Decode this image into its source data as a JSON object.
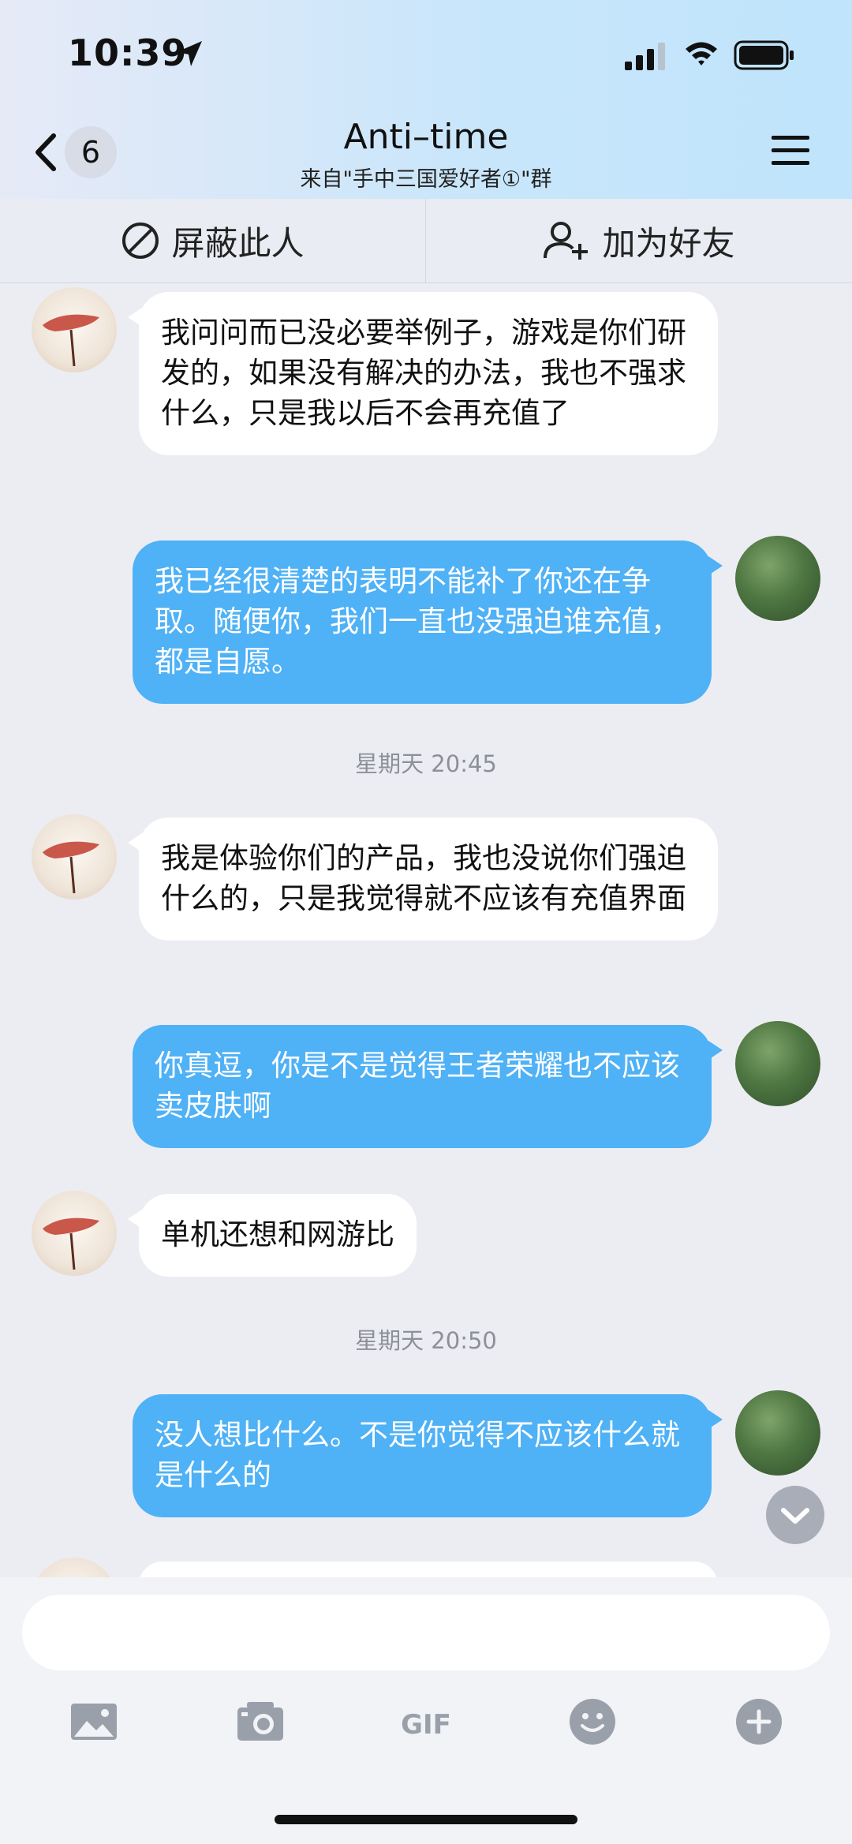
{
  "status_bar": {
    "time": "10:39"
  },
  "header": {
    "unread_count": "6",
    "title": "Anti–time",
    "subtitle": "来自\"手中三国爱好者①\"群"
  },
  "actions": {
    "block_label": "屏蔽此人",
    "add_friend_label": "加为好友"
  },
  "messages": [
    {
      "from": "other",
      "text": "我问问而已没必要举例子，游戏是你们研发的，如果没有解决的办法，我也不强求什么，只是我以后不会再充值了"
    },
    {
      "from": "self",
      "text": "我已经很清楚的表明不能补了你还在争取。随便你，我们一直也没强迫谁充值，都是自愿。"
    },
    {
      "timestamp": "星期天 20:45"
    },
    {
      "from": "other",
      "text": "我是体验你们的产品，我也没说你们强迫什么的，只是我觉得就不应该有充值界面"
    },
    {
      "from": "self",
      "text": "你真逗，你是不是觉得王者荣耀也不应该卖皮肤啊"
    },
    {
      "from": "other",
      "text": "单机还想和网游比"
    },
    {
      "timestamp": "星期天 20:50"
    },
    {
      "from": "self",
      "text": "没人想比什么。不是你觉得不应该什么就是什么的"
    }
  ],
  "input": {
    "value": "",
    "placeholder": ""
  },
  "toolbar": {
    "gif_label": "GIF"
  },
  "colors": {
    "outgoing_bubble": "#4fb1f6",
    "incoming_bubble": "#ffffff",
    "background": "#ecedf3"
  }
}
